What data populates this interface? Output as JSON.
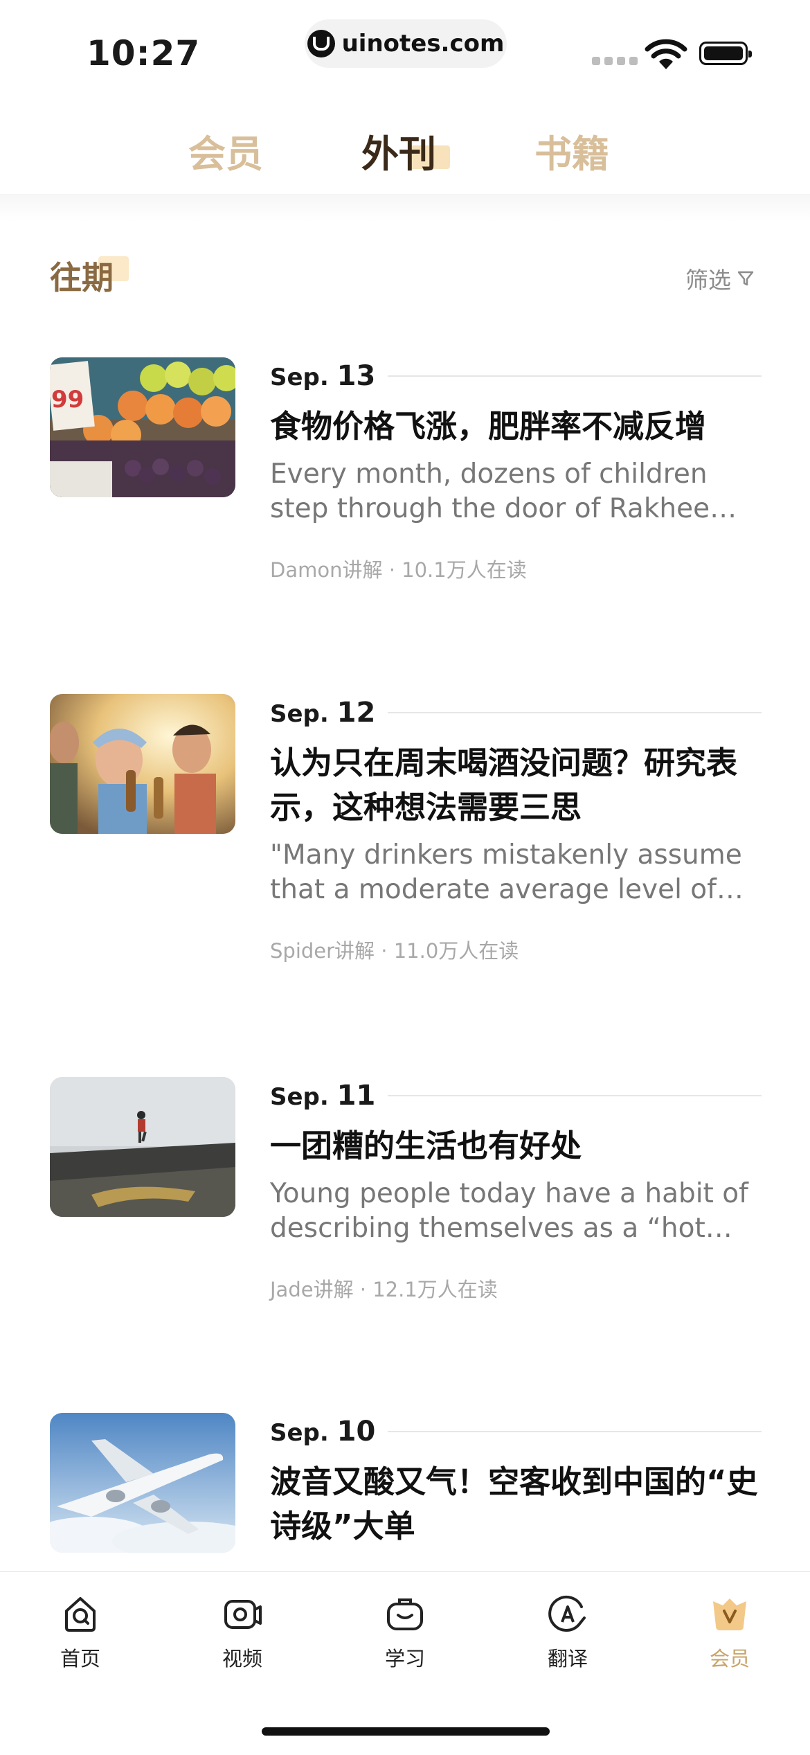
{
  "status": {
    "time": "10:27",
    "url": "uinotes.com"
  },
  "tabs": [
    {
      "label": "会员",
      "active": false
    },
    {
      "label": "外刊",
      "active": true
    },
    {
      "label": "书籍",
      "active": false
    }
  ],
  "section": {
    "title": "往期",
    "filter_label": "筛选"
  },
  "articles": [
    {
      "month": "Sep.",
      "day": "13",
      "title": "食物价格飞涨，肥胖率不减反增",
      "summary": "Every month, dozens of children step through the door of Rakhee S…",
      "meta": "Damon讲解 · 10.1万人在读",
      "image_icon": "fruit-market-photo"
    },
    {
      "month": "Sep.",
      "day": "12",
      "title": "认为只在周末喝酒没问题？研究表示，这种想法需要三思",
      "summary": "\"Many drinkers mistakenly assume that a moderate average level of c…",
      "meta": "Spider讲解 · 11.0万人在读",
      "image_icon": "friends-toasting-photo"
    },
    {
      "month": "Sep.",
      "day": "11",
      "title": "一团糟的生活也有好处",
      "summary": "Young people today have a habit of describing themselves as a “hot m…",
      "meta": "Jade讲解 · 12.1万人在读",
      "image_icon": "runner-road-photo"
    },
    {
      "month": "Sep.",
      "day": "10",
      "title": "波音又酸又气！空客收到中国的“史诗级”大单",
      "summary": "",
      "meta": "",
      "image_icon": "airplane-photo"
    }
  ],
  "bottom_nav": [
    {
      "label": "首页",
      "icon": "home-icon",
      "active": false
    },
    {
      "label": "视频",
      "icon": "video-icon",
      "active": false
    },
    {
      "label": "学习",
      "icon": "study-icon",
      "active": false
    },
    {
      "label": "翻译",
      "icon": "translate-icon",
      "active": false
    },
    {
      "label": "会员",
      "icon": "vip-crown-icon",
      "active": true
    }
  ],
  "colors": {
    "accent": "#c9a46a",
    "active_tab": "#3b2a19",
    "inactive_tab": "#d8bf9a"
  }
}
